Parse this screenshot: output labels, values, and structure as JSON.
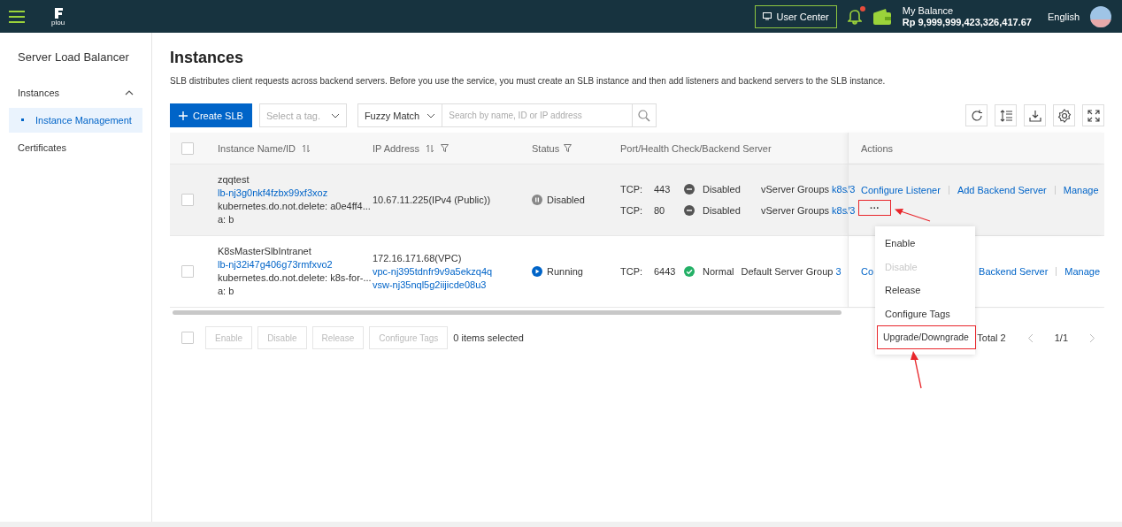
{
  "topbar": {
    "logo": "plou",
    "user_center": "User Center",
    "notification_badge": true,
    "balance_label": "My Balance",
    "balance_value": "Rp 9,999,999,423,326,417.67",
    "language": "English"
  },
  "sidebar": {
    "title": "Server Load Balancer",
    "groups": [
      {
        "label": "Instances",
        "expanded": true,
        "children": [
          {
            "label": "Instance Management",
            "selected": true
          }
        ]
      },
      {
        "label": "Certificates"
      }
    ]
  },
  "page": {
    "title": "Instances",
    "description": "SLB distributes client requests across backend servers. Before you use the service, you must create an SLB instance and then add listeners and backend servers to the SLB instance."
  },
  "toolbar": {
    "create": "Create SLB",
    "tag_placeholder": "Select a tag.",
    "match_mode": "Fuzzy Match",
    "search_placeholder": "Search by name, ID or IP address"
  },
  "table": {
    "select_all_checked": false,
    "columns": [
      {
        "label": "Instance Name/ID",
        "sortable": true,
        "filterable": false
      },
      {
        "label": "IP Address",
        "sortable": true,
        "filterable": true
      },
      {
        "label": "Status",
        "sortable": false,
        "filterable": true
      },
      {
        "label": "Port/Health Check/Backend Server",
        "sortable": false,
        "filterable": false
      },
      {
        "label": "Actions",
        "sortable": false,
        "filterable": false
      }
    ],
    "rows": [
      {
        "checked": false,
        "highlighted": true,
        "name": "zqqtest",
        "id": "lb-nj3g0nkf4fzbx99xf3xoz",
        "tags": [
          "kubernetes.do.not.delete: a0e4ff4...",
          "a: b"
        ],
        "ip": [
          {
            "text": "10.67.11.225(IPv4 (Public))",
            "link": false
          }
        ],
        "status": {
          "kind": "disabled",
          "label": "Disabled"
        },
        "listeners": [
          {
            "protocol": "TCP:",
            "port": "443",
            "kind": "disabled",
            "health_label": "Disabled",
            "group": "vServer Groups",
            "group_link": "k8s/3"
          },
          {
            "protocol": "TCP:",
            "port": "80",
            "kind": "disabled",
            "health_label": "Disabled",
            "group": "vServer Groups",
            "group_link": "k8s/3"
          }
        ],
        "actions": [
          "Configure Listener",
          "Add Backend Server",
          "Manage"
        ],
        "more": "···"
      },
      {
        "checked": false,
        "highlighted": false,
        "name": "K8sMasterSlbIntranet",
        "id": "lb-nj32i47g406g73rmfxvo2",
        "tags": [
          "kubernetes.do.not.delete: k8s-for-...",
          "a: b"
        ],
        "ip": [
          {
            "text": "172.16.171.68(VPC)",
            "link": false
          },
          {
            "text": "vpc-nj395tdnfr9v9a5ekzq4q",
            "link": true
          },
          {
            "text": "vsw-nj35nql5g2iijicde08u3",
            "link": true
          }
        ],
        "status": {
          "kind": "running",
          "label": "Running"
        },
        "listeners": [
          {
            "protocol": "TCP:",
            "port": "6443",
            "kind": "normal",
            "health_label": "Normal",
            "group": "Default Server Group",
            "group_link": "3"
          }
        ],
        "actions": [
          "Co",
          "Backend Server",
          "Manage"
        ]
      }
    ]
  },
  "footer": {
    "checked": false,
    "buttons": [
      {
        "label": "Enable",
        "disabled": true
      },
      {
        "label": "Disable",
        "disabled": true
      },
      {
        "label": "Release",
        "disabled": true
      },
      {
        "label": "Configure Tags",
        "disabled": true
      }
    ],
    "selected_count": "0 items selected",
    "total": "Total 2",
    "page": "1/1"
  },
  "more_menu": {
    "items": [
      {
        "label": "Enable",
        "disabled": false,
        "highlighted": false
      },
      {
        "label": "Disable",
        "disabled": true,
        "highlighted": false
      },
      {
        "label": "Release",
        "disabled": false,
        "highlighted": false
      },
      {
        "label": "Configure Tags",
        "disabled": false,
        "highlighted": false
      },
      {
        "label": "Upgrade/Downgrade",
        "disabled": false,
        "highlighted": true
      }
    ]
  }
}
